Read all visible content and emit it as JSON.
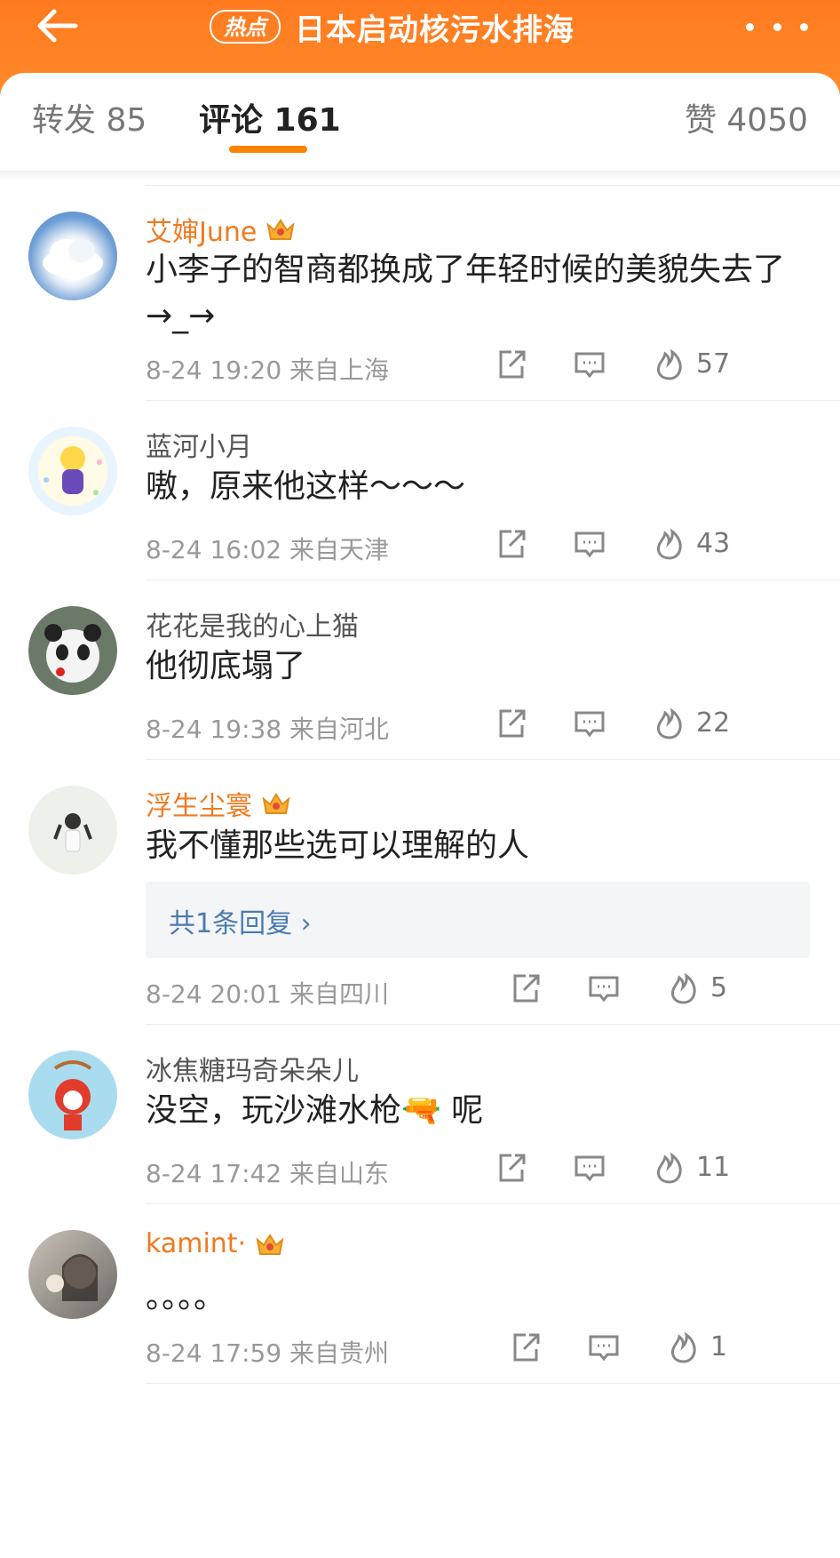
{
  "header": {
    "hot_badge": "热点",
    "title": "日本启动核污水排海"
  },
  "tabs": {
    "repost": "转发 85",
    "comment": "评论 161",
    "like": "赞 4050"
  },
  "colors": {
    "accent": "#ff8200",
    "vip_name": "#f07a1f",
    "link": "#4a7ab0"
  },
  "comments": [
    {
      "name": "艾婶June",
      "vip": true,
      "text": "小李子的智商都换成了年轻时候的美貌失去了→_→",
      "meta": "8-24 19:20 来自上海",
      "likes": "57",
      "avatar": "cloud-avatar"
    },
    {
      "name": "蓝河小月",
      "vip": false,
      "text": "嗷，原来他这样～～～",
      "meta": "8-24 16:02 来自天津",
      "likes": "43",
      "avatar": "anime-avatar"
    },
    {
      "name": "花花是我的心上猫",
      "vip": false,
      "text": "他彻底塌了",
      "meta": "8-24 19:38 来自河北",
      "likes": "22",
      "avatar": "panda-avatar"
    },
    {
      "name": "浮生尘寰",
      "vip": true,
      "text": "我不懂那些选可以理解的人",
      "reply_link": "共1条回复 ›",
      "meta": "8-24 20:01 来自四川",
      "likes": "5",
      "avatar": "girl-avatar"
    },
    {
      "name": "冰焦糖玛奇朵朵儿",
      "vip": false,
      "text": "没空，玩沙滩水枪🔫 呢",
      "meta": "8-24 17:42 来自山东",
      "likes": "11",
      "avatar": "fox-avatar"
    },
    {
      "name": "kamint·",
      "vip": true,
      "text": "。。。。",
      "meta": "8-24 17:59 来自贵州",
      "likes": "1",
      "avatar": "photo-avatar"
    }
  ]
}
